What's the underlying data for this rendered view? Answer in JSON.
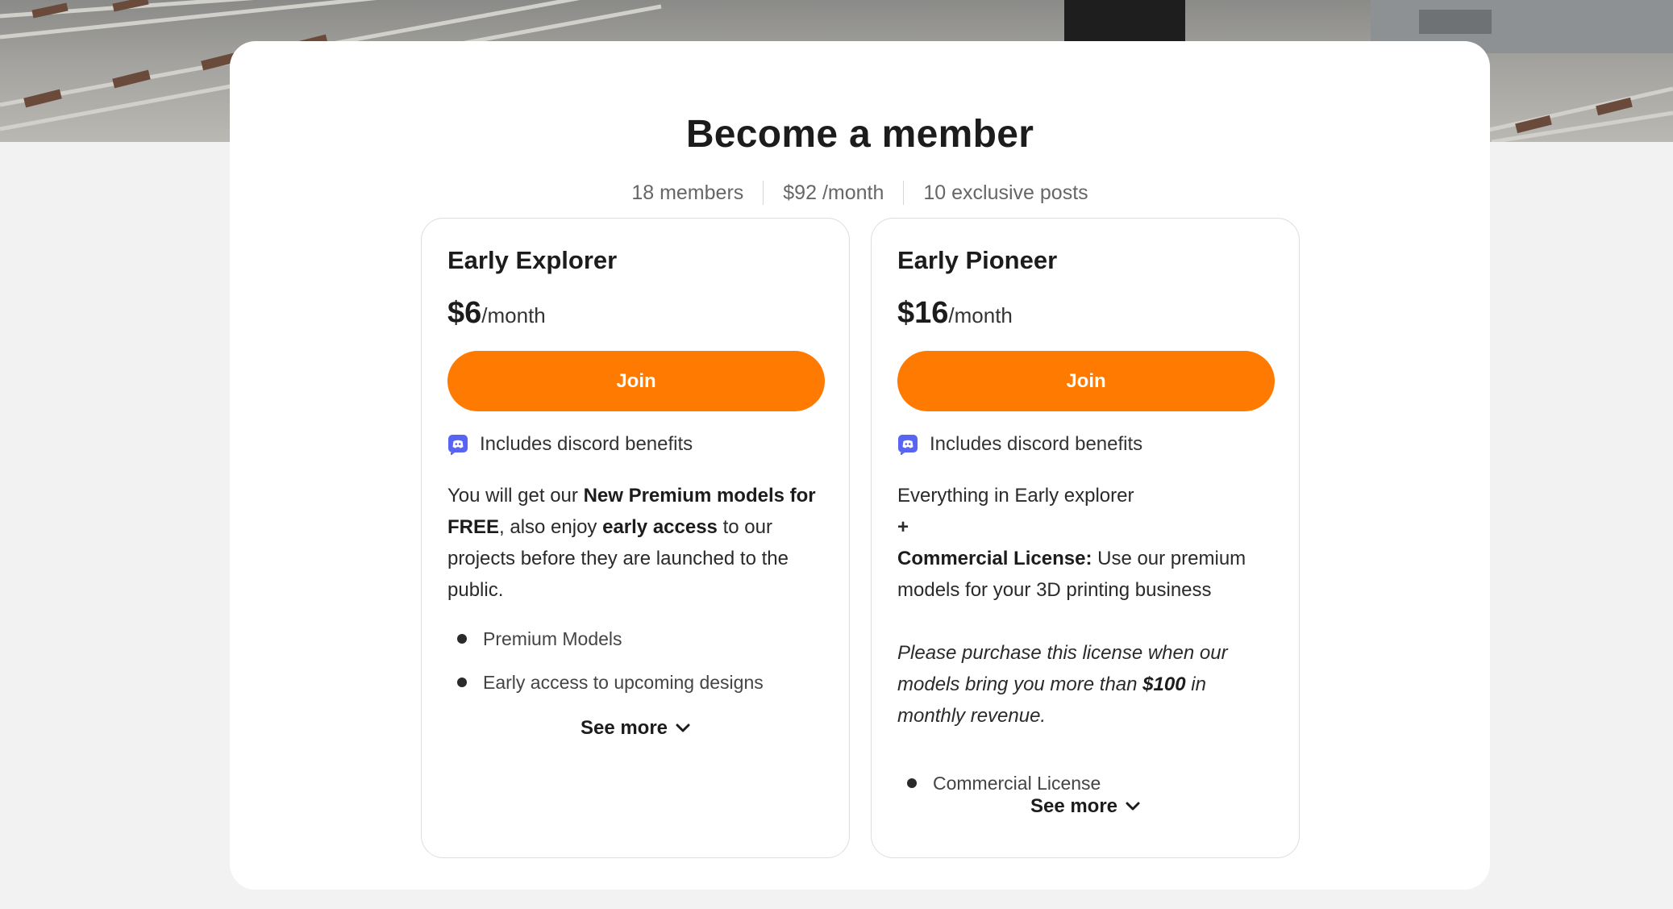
{
  "header": {
    "title": "Become a member",
    "stats": {
      "members": "18 members",
      "price": "$92 /month",
      "posts": "10 exclusive posts"
    }
  },
  "tiers": [
    {
      "name": "Early Explorer",
      "price_amount": "$6",
      "price_period": "/month",
      "join_label": "Join",
      "discord_label": "Includes discord benefits",
      "discord_icon": "discord-icon",
      "description": {
        "p1_a": "You will get our ",
        "p1_b": "New Premium models for FREE",
        "p1_c": ", also enjoy ",
        "p1_d": "early access",
        "p1_e": " to our projects before they are launched to the public."
      },
      "benefits": [
        "Premium Models",
        "Early access to upcoming designs"
      ],
      "see_more": "See more"
    },
    {
      "name": "Early Pioneer",
      "price_amount": "$16",
      "price_period": "/month",
      "join_label": "Join",
      "discord_label": "Includes discord benefits",
      "discord_icon": "discord-icon",
      "description": {
        "line1": "Everything in Early explorer",
        "line2": "+",
        "license_label": "Commercial License:",
        "license_text": " Use our premium models for your 3D printing business",
        "note_a": "Please purchase this license when our models bring you more than ",
        "note_b": "$100",
        "note_c": " in monthly revenue."
      },
      "benefits": [
        "Commercial License"
      ],
      "see_more": "See more"
    }
  ],
  "colors": {
    "accent": "#ff7a00",
    "discord": "#5865f2"
  }
}
